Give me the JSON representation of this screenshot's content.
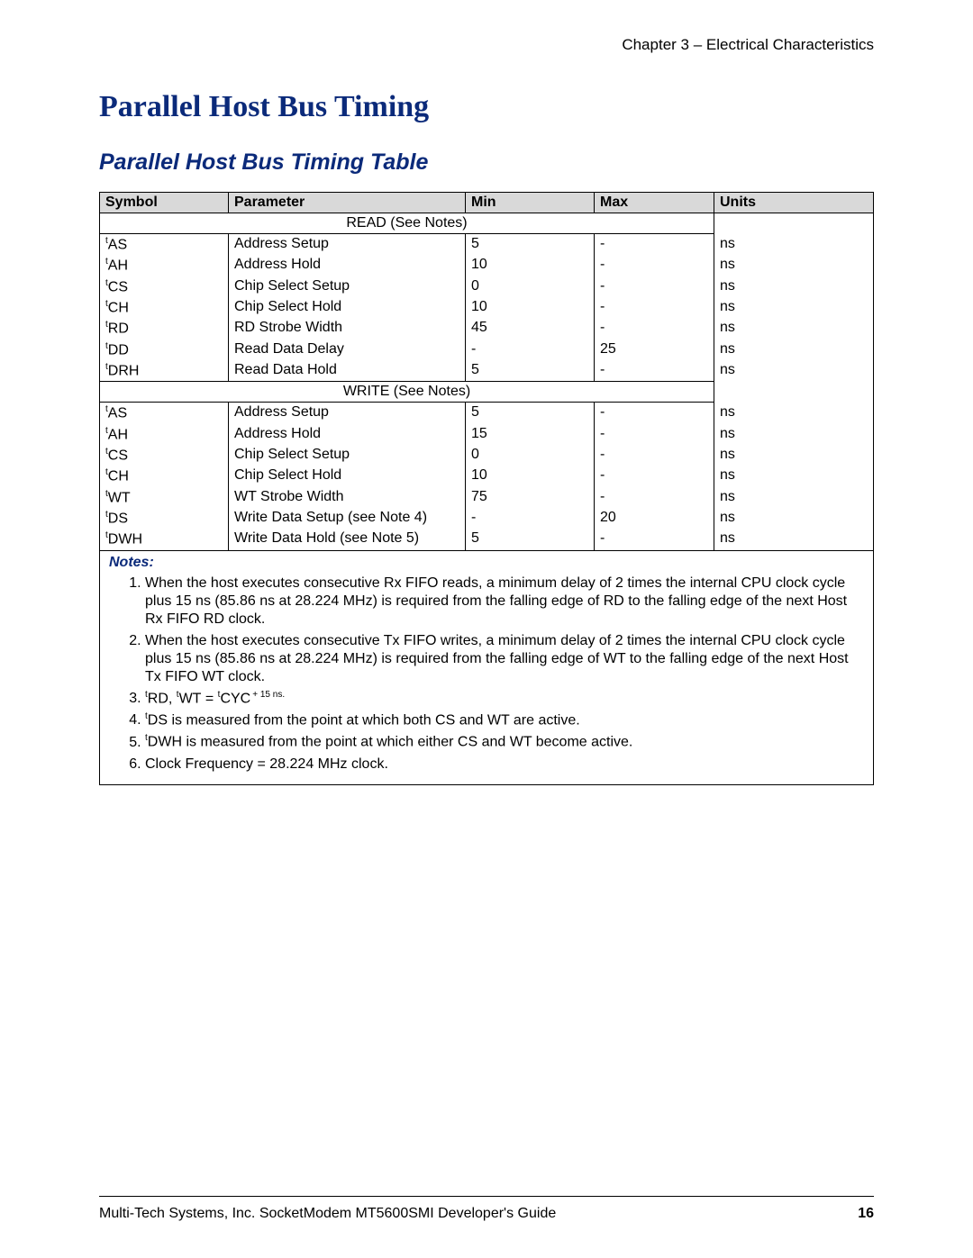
{
  "chapter": "Chapter 3 – Electrical Characteristics",
  "title": "Parallel Host Bus Timing",
  "subtitle": "Parallel Host Bus Timing Table",
  "headers": {
    "symbol": "Symbol",
    "parameter": "Parameter",
    "min": "Min",
    "max": "Max",
    "units": "Units"
  },
  "sections": {
    "read": "READ (See Notes)",
    "write": "WRITE (See Notes)"
  },
  "rows_read": [
    {
      "sym": "AS",
      "param": "Address Setup",
      "min": "5",
      "max": "-",
      "units": "ns"
    },
    {
      "sym": "AH",
      "param": "Address Hold",
      "min": "10",
      "max": "-",
      "units": "ns"
    },
    {
      "sym": "CS",
      "param": "Chip Select Setup",
      "min": "0",
      "max": "-",
      "units": "ns"
    },
    {
      "sym": "CH",
      "param": "Chip Select Hold",
      "min": "10",
      "max": "-",
      "units": "ns"
    },
    {
      "sym": "RD",
      "param": "RD Strobe Width",
      "min": "45",
      "max": "-",
      "units": "ns"
    },
    {
      "sym": "DD",
      "param": "Read Data Delay",
      "min": "-",
      "max": "25",
      "units": "ns"
    },
    {
      "sym": "DRH",
      "param": "Read Data Hold",
      "min": "5",
      "max": "-",
      "units": "ns"
    }
  ],
  "rows_write": [
    {
      "sym": "AS",
      "param": "Address Setup",
      "min": "5",
      "max": "-",
      "units": "ns"
    },
    {
      "sym": "AH",
      "param": "Address Hold",
      "min": "15",
      "max": "-",
      "units": "ns"
    },
    {
      "sym": "CS",
      "param": "Chip Select Setup",
      "min": "0",
      "max": "-",
      "units": "ns"
    },
    {
      "sym": "CH",
      "param": "Chip Select Hold",
      "min": "10",
      "max": "-",
      "units": "ns"
    },
    {
      "sym": "WT",
      "param": "WT Strobe Width",
      "min": "75",
      "max": "-",
      "units": "ns"
    },
    {
      "sym": "DS",
      "param": "Write Data Setup (see Note 4)",
      "min": "-",
      "max": "20",
      "units": "ns"
    },
    {
      "sym": "DWH",
      "param": "Write Data Hold (see Note 5)",
      "min": "5",
      "max": "-",
      "units": "ns"
    }
  ],
  "notes_label": "Notes:",
  "notes": [
    "When the host executes consecutive Rx FIFO reads, a minimum delay of 2 times the internal CPU clock cycle plus 15 ns (85.86 ns at 28.224 MHz) is required from the falling edge of RD to the falling edge of the next Host Rx FIFO RD clock.",
    "When the host executes consecutive Tx FIFO writes, a minimum delay of 2 times the internal CPU clock cycle plus 15 ns (85.86 ns at 28.224 MHz) is required from the falling edge of WT to the falling edge of the next Host Tx FIFO WT clock."
  ],
  "note3": {
    "a": "RD",
    "b": "WT",
    "c": "CYC",
    "tail": "+ 15 ns."
  },
  "note4": "DS is measured from the point at which both CS and WT are active.",
  "note5": "DWH is measured from the point at which either CS and WT become active.",
  "note6": "Clock Frequency = 28.224 MHz clock.",
  "footer": {
    "text": "Multi-Tech Systems, Inc. SocketModem MT5600SMI Developer's Guide",
    "page": "16"
  }
}
